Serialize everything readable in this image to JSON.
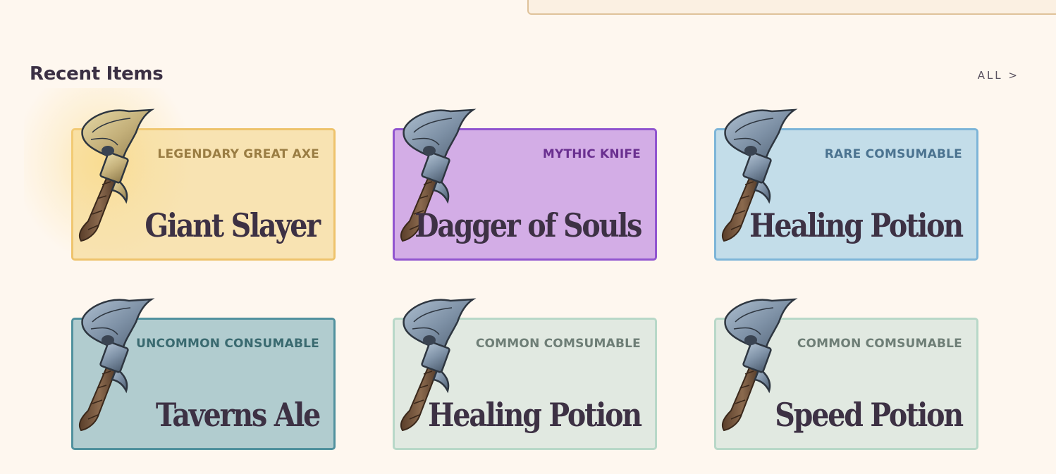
{
  "section": {
    "title": "Recent Items",
    "all_link": "ALL >"
  },
  "colors": {
    "background": "#fef7ef",
    "text": "#3b3044",
    "legendary": "#f8e3b2",
    "mythic": "#d3ade6",
    "rare": "#c3dde9",
    "uncommon": "#b1cccf",
    "common": "#e1e9e1"
  },
  "items": [
    {
      "rarity": "LEGENDARY GREAT AXE",
      "name": "Giant Slayer",
      "icon": "golden-axe-icon"
    },
    {
      "rarity": "MYTHIC KNIFE",
      "name": "Dagger of Souls",
      "icon": "steel-axe-icon"
    },
    {
      "rarity": "RARE COMSUMABLE",
      "name": "Healing Potion",
      "icon": "steel-axe-icon"
    },
    {
      "rarity": "UNCOMMON CONSUMABLE",
      "name": "Taverns Ale",
      "icon": "steel-axe-icon"
    },
    {
      "rarity": "COMMON COMSUMABLE",
      "name": "Healing Potion",
      "icon": "steel-axe-icon"
    },
    {
      "rarity": "COMMON COMSUMABLE",
      "name": "Speed Potion",
      "icon": "steel-axe-icon"
    }
  ]
}
